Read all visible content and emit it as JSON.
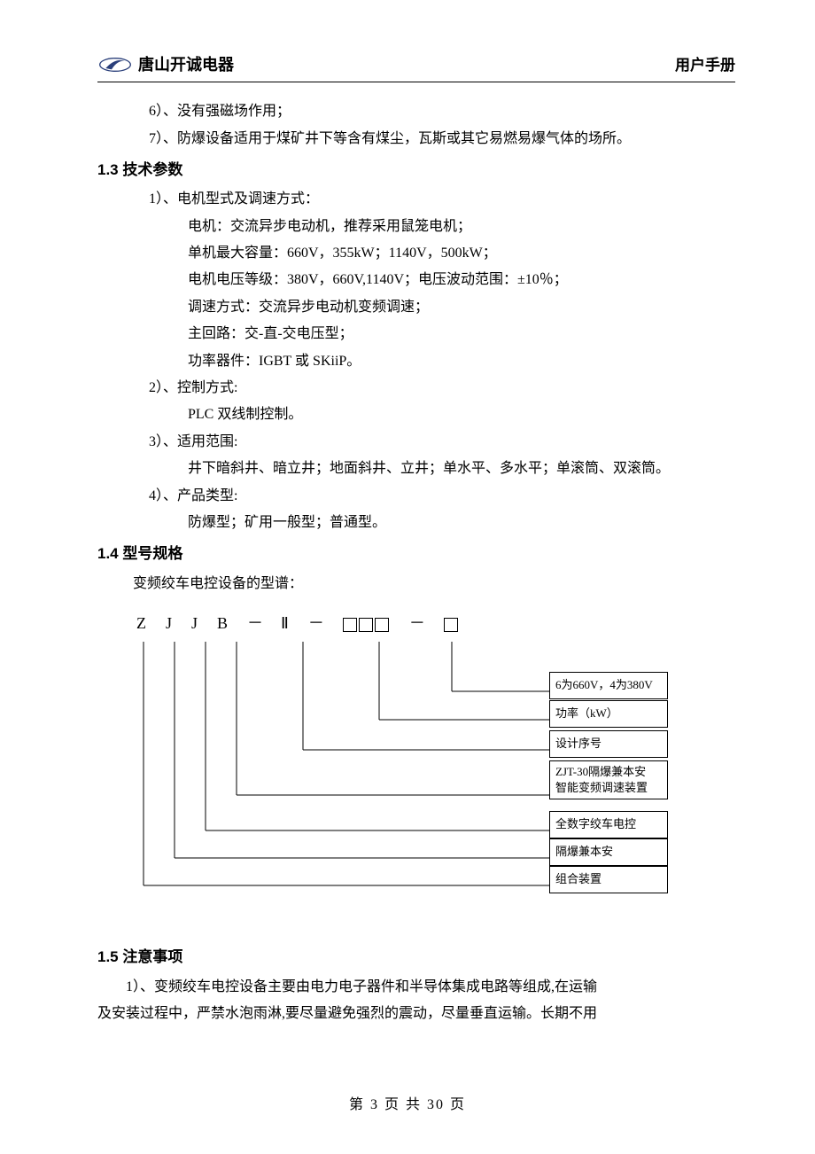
{
  "header": {
    "company": "唐山开诚电器",
    "doc_type": "用户手册"
  },
  "pre_lines": {
    "i6": "6）、没有强磁场作用；",
    "i7": "7）、防爆设备适用于煤矿井下等含有煤尘，瓦斯或其它易燃易爆气体的场所。"
  },
  "s13": {
    "title": "1.3 技术参数",
    "l1": "1）、电机型式及调速方式：",
    "l1a": "电机：交流异步电动机，推荐采用鼠笼电机；",
    "l1b": "单机最大容量：660V，355kW；1140V，500kW；",
    "l1c": "电机电压等级：380V，660V,1140V；电压波动范围：±10％；",
    "l1d": "调速方式：交流异步电动机变频调速；",
    "l1e": "主回路：交-直-交电压型；",
    "l1f": "功率器件：IGBT 或 SKiiP。",
    "l2": "2）、控制方式:",
    "l2a": "PLC 双线制控制。",
    "l3": "3）、适用范围:",
    "l3a": "井下暗斜井、暗立井；地面斜井、立井；单水平、多水平；单滚筒、双滚筒。",
    "l4": "4）、产品类型:",
    "l4a": "防爆型；矿用一般型；普通型。"
  },
  "s14": {
    "title": "1.4 型号规格",
    "intro": "变频绞车电控设备的型谱：",
    "model": {
      "c1": "Z",
      "c2": "J",
      "c3": "J",
      "c4": "B",
      "c5": "Ⅱ",
      "labels": {
        "voltage": "6为660V，4为380V",
        "power": "功率（kW）",
        "design": "设计序号",
        "zjt_a": "ZJT-30隔爆兼本安",
        "zjt_b": "智能变频调速装置",
        "digital": "全数字绞车电控",
        "flameproof": "隔爆兼本安",
        "combo": "组合装置"
      }
    }
  },
  "s15": {
    "title": "1.5 注意事项",
    "p1a": "1）、变频绞车电控设备主要由电力电子器件和半导体集成电路等组成,在运输",
    "p1b": "及安装过程中，严禁水泡雨淋,要尽量避免强烈的震动，尽量垂直运输。长期不用"
  },
  "footer": {
    "page": "第 3 页 共 30 页"
  }
}
